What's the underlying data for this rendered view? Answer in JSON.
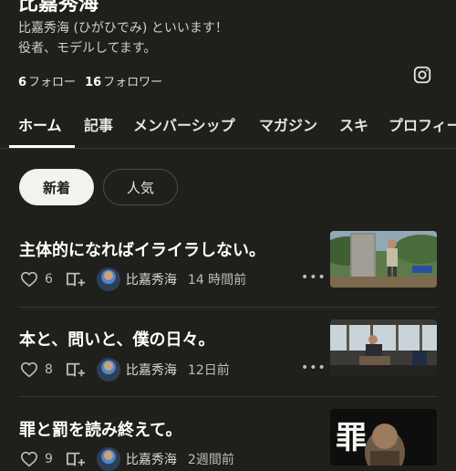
{
  "profile": {
    "name": "比嘉秀海",
    "bio_line1": "比嘉秀海 (ひがひでみ) といいます！",
    "bio_line2": "役者、モデルしてます。",
    "following_count": "6",
    "following_label": "フォロー",
    "followers_count": "16",
    "followers_label": "フォロワー",
    "instagram_icon": "instagram-icon"
  },
  "tabs": [
    {
      "label": "ホーム",
      "active": true
    },
    {
      "label": "記事"
    },
    {
      "label": "メンバーシップ"
    },
    {
      "label": "マガジン"
    },
    {
      "label": "スキ"
    },
    {
      "label": "プロフィー"
    }
  ],
  "filters": {
    "new": "新着",
    "popular": "人気"
  },
  "articles": [
    {
      "title": "主体的になればイライラしない。",
      "likes": "6",
      "author": "比嘉秀海",
      "time": "14 時間前",
      "thumb": "man-by-stone-monument"
    },
    {
      "title": "本と、問いと、僕の日々。",
      "likes": "8",
      "author": "比嘉秀海",
      "time": "12日前",
      "thumb": "man-sitting-indoors"
    },
    {
      "title": "罪と罰を読み終えて。",
      "likes": "9",
      "author": "比嘉秀海",
      "time": "2週間前",
      "thumb": "book-cover-crime-and-punishment",
      "thumb_text": "罪 罰"
    }
  ],
  "colors": {
    "background": "#1f201b",
    "text": "#ffffff",
    "muted": "#bdbdb6",
    "pill_active_bg": "#f2f2ee"
  }
}
